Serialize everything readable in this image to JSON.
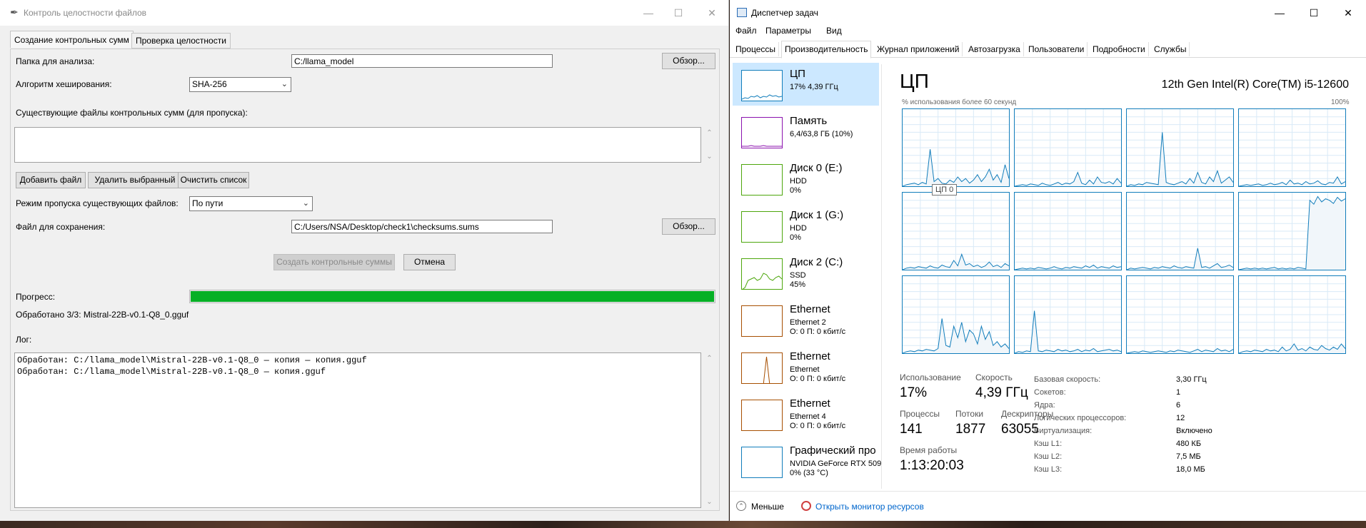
{
  "checker": {
    "title": "Контроль целостности файлов",
    "tabs": [
      "Создание контрольных сумм",
      "Проверка целостности"
    ],
    "folder_label": "Папка для анализа:",
    "folder_value": "C:/llama_model",
    "browse_label": "Обзор...",
    "algo_label": "Алгоритм хеширования:",
    "algo_value": "SHA-256",
    "existing_label": "Существующие файлы контрольных сумм (для пропуска):",
    "add_file": "Добавить файл",
    "remove_selected": "Удалить выбранный",
    "clear_list": "Очистить список",
    "skip_mode_label": "Режим пропуска существующих файлов:",
    "skip_mode_value": "По пути",
    "save_label": "Файл для сохранения:",
    "save_value": "C:/Users/NSA/Desktop/check1\\checksums.sums",
    "browse2_label": "Обзор...",
    "create_button": "Создать контрольные суммы",
    "cancel_button": "Отмена",
    "progress_label": "Прогресс:",
    "progress_value": 1.0,
    "processed_text": "Обработано 3/3: Mistral-22B-v0.1-Q8_0.gguf",
    "log_label": "Лог:",
    "log_lines": [
      "Обработан: C:/llama_model\\Mistral-22B-v0.1-Q8_0 — копия — копия.gguf",
      "Обработан: C:/llama_model\\Mistral-22B-v0.1-Q8_0 — копия.gguf"
    ]
  },
  "taskmgr": {
    "title": "Диспетчер задач",
    "menu": [
      "Файл",
      "Параметры",
      "Вид"
    ],
    "tabs": [
      "Процессы",
      "Производительность",
      "Журнал приложений",
      "Автозагрузка",
      "Пользователи",
      "Подробности",
      "Службы"
    ],
    "sidebar": [
      {
        "name": "ЦП",
        "l2": "17% 4,39 ГГц",
        "l3": "",
        "color": "#117dbb"
      },
      {
        "name": "Память",
        "l2": "6,4/63,8 ГБ (10%)",
        "l3": "",
        "color": "#8b12ae"
      },
      {
        "name": "Диск 0 (E:)",
        "l2": "HDD",
        "l3": "0%",
        "color": "#4da60c"
      },
      {
        "name": "Диск 1 (G:)",
        "l2": "HDD",
        "l3": "0%",
        "color": "#4da60c"
      },
      {
        "name": "Диск 2 (C:)",
        "l2": "SSD",
        "l3": "45%",
        "color": "#4da60c"
      },
      {
        "name": "Ethernet",
        "l2": "Ethernet 2",
        "l3": "О: 0 П: 0 кбит/с",
        "color": "#a74f01"
      },
      {
        "name": "Ethernet",
        "l2": "Ethernet",
        "l3": "О: 0 П: 0 кбит/с",
        "color": "#a74f01"
      },
      {
        "name": "Ethernet",
        "l2": "Ethernet 4",
        "l3": "О: 0 П: 0 кбит/с",
        "color": "#a74f01"
      },
      {
        "name": "Графический про",
        "l2": "NVIDIA GeForce RTX 509",
        "l3": "0% (33 °C)",
        "color": "#117dbb"
      }
    ],
    "cpu_title": "ЦП",
    "cpu_model": "12th Gen Intel(R) Core(TM) i5-12600",
    "usage_caption": "% использования более 60 секунд",
    "max_caption": "100%",
    "tooltip": "ЦП 0",
    "core_series": [
      [
        0,
        2,
        3,
        4,
        2,
        5,
        3,
        48,
        6,
        10,
        4,
        3,
        8,
        5,
        12,
        6,
        10,
        4,
        8,
        15,
        6,
        12,
        22,
        8,
        15,
        5,
        28,
        10
      ],
      [
        0,
        1,
        2,
        1,
        3,
        2,
        1,
        4,
        2,
        1,
        3,
        5,
        2,
        4,
        3,
        6,
        18,
        4,
        2,
        8,
        3,
        12,
        5,
        4,
        6,
        3,
        10,
        4
      ],
      [
        0,
        2,
        1,
        3,
        2,
        5,
        4,
        3,
        2,
        70,
        5,
        3,
        2,
        4,
        6,
        3,
        10,
        4,
        18,
        5,
        3,
        12,
        6,
        20,
        4,
        8,
        12,
        5
      ],
      [
        0,
        1,
        2,
        1,
        2,
        3,
        1,
        2,
        4,
        2,
        3,
        5,
        2,
        8,
        3,
        4,
        2,
        6,
        3,
        4,
        7,
        3,
        2,
        5,
        4,
        12,
        3,
        6
      ],
      [
        0,
        2,
        3,
        2,
        4,
        3,
        2,
        5,
        3,
        2,
        6,
        4,
        3,
        12,
        5,
        20,
        6,
        8,
        4,
        6,
        3,
        5,
        10,
        4,
        6,
        3,
        8,
        5
      ],
      [
        0,
        1,
        2,
        1,
        2,
        1,
        3,
        2,
        1,
        2,
        4,
        2,
        1,
        3,
        2,
        4,
        3,
        2,
        5,
        3,
        6,
        2,
        4,
        3,
        2,
        5,
        3,
        4
      ],
      [
        0,
        2,
        1,
        2,
        3,
        2,
        1,
        3,
        2,
        4,
        3,
        2,
        5,
        3,
        2,
        4,
        3,
        2,
        28,
        3,
        4,
        2,
        5,
        8,
        3,
        4,
        6,
        3
      ],
      [
        0,
        1,
        2,
        1,
        2,
        1,
        2,
        1,
        2,
        3,
        1,
        2,
        1,
        2,
        1,
        3,
        2,
        1,
        90,
        85,
        95,
        88,
        92,
        90,
        86,
        94,
        89,
        92
      ],
      [
        0,
        2,
        3,
        2,
        4,
        3,
        5,
        4,
        3,
        6,
        45,
        10,
        8,
        35,
        20,
        40,
        15,
        30,
        25,
        12,
        35,
        18,
        28,
        10,
        15,
        8,
        12,
        6
      ],
      [
        0,
        2,
        1,
        3,
        2,
        55,
        3,
        2,
        4,
        3,
        2,
        5,
        3,
        4,
        2,
        3,
        5,
        2,
        4,
        3,
        6,
        2,
        3,
        4,
        5,
        3,
        4,
        2
      ],
      [
        0,
        1,
        2,
        1,
        3,
        2,
        1,
        2,
        3,
        2,
        1,
        3,
        2,
        4,
        3,
        2,
        1,
        3,
        5,
        2,
        4,
        3,
        2,
        6,
        3,
        4,
        2,
        5
      ],
      [
        0,
        2,
        3,
        2,
        4,
        3,
        2,
        5,
        3,
        4,
        2,
        8,
        3,
        5,
        12,
        4,
        6,
        3,
        8,
        5,
        4,
        10,
        6,
        4,
        8,
        5,
        12,
        6
      ]
    ],
    "stats": {
      "usage_label": "Использование",
      "usage_value": "17%",
      "speed_label": "Скорость",
      "speed_value": "4,39 ГГц",
      "proc_label": "Процессы",
      "proc_value": "141",
      "threads_label": "Потоки",
      "threads_value": "1877",
      "handles_label": "Дескрипторы",
      "handles_value": "63055",
      "uptime_label": "Время работы",
      "uptime_value": "1:13:20:03"
    },
    "specs": [
      {
        "k": "Базовая скорость:",
        "v": "3,30 ГГц"
      },
      {
        "k": "Сокетов:",
        "v": "1"
      },
      {
        "k": "Ядра:",
        "v": "6"
      },
      {
        "k": "Логических процессоров:",
        "v": "12"
      },
      {
        "k": "Виртуализация:",
        "v": "Включено"
      },
      {
        "k": "Кэш L1:",
        "v": "480 КБ"
      },
      {
        "k": "Кэш L2:",
        "v": "7,5 МБ"
      },
      {
        "k": "Кэш L3:",
        "v": "18,0 МБ"
      }
    ],
    "footer_less": "Меньше",
    "footer_link": "Открыть монитор ресурсов"
  }
}
